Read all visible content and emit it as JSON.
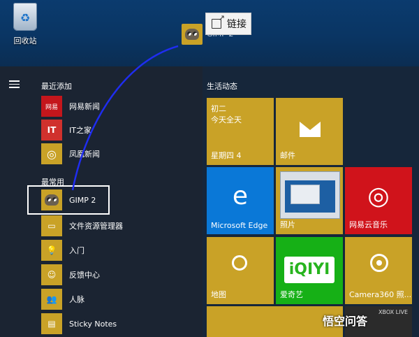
{
  "desktop": {
    "recycle_bin_label": "回收站",
    "drag_label": "GIMP 2",
    "tooltip_text": "链接"
  },
  "start": {
    "recent_title": "最近添加",
    "frequent_title": "最常用",
    "recent_apps": [
      {
        "label": "网易新闻",
        "icon": "news-icon",
        "badge": "网易",
        "color": "#c4161c"
      },
      {
        "label": "IT之家",
        "icon": "it-icon",
        "badge": "IT",
        "color": "#d0312d"
      },
      {
        "label": "凤凰新闻",
        "icon": "phoenix-icon",
        "badge": "◎",
        "color": "#c9a227"
      }
    ],
    "frequent_apps": [
      {
        "label": "GIMP 2",
        "icon": "gimp-icon",
        "color": "#c9a227"
      },
      {
        "label": "文件资源管理器",
        "icon": "folder-icon",
        "color": "#c9a227"
      },
      {
        "label": "入门",
        "icon": "bulb-icon",
        "color": "#c9a227"
      },
      {
        "label": "反馈中心",
        "icon": "feedback-icon",
        "color": "#c9a227"
      },
      {
        "label": "人脉",
        "icon": "people-icon",
        "color": "#c9a227"
      },
      {
        "label": "Sticky Notes",
        "icon": "sticky-notes-icon",
        "color": "#c9a227"
      }
    ]
  },
  "tiles": {
    "group_title": "生活动态",
    "calendar": {
      "line1": "初二",
      "line2": "今天全天",
      "label": "星期四 4",
      "color": "#c9a227"
    },
    "mail": {
      "label": "邮件",
      "color": "#c9a227"
    },
    "edge": {
      "label": "Microsoft Edge",
      "color": "#0a78d7"
    },
    "photos": {
      "label": "照片",
      "color": "#c9a227"
    },
    "music": {
      "label": "网易云音乐",
      "color": "#d0131b"
    },
    "maps": {
      "label": "地图",
      "color": "#c9a227"
    },
    "iqiyi": {
      "label": "爱奇艺",
      "logo": "iQIYI",
      "color": "#16b016"
    },
    "camera": {
      "label": "Camera360 照...",
      "color": "#c9a227"
    },
    "xbox": {
      "badge": "XBOX LIVE",
      "color": "#2b2b2b"
    }
  },
  "watermark": "悟空问答"
}
